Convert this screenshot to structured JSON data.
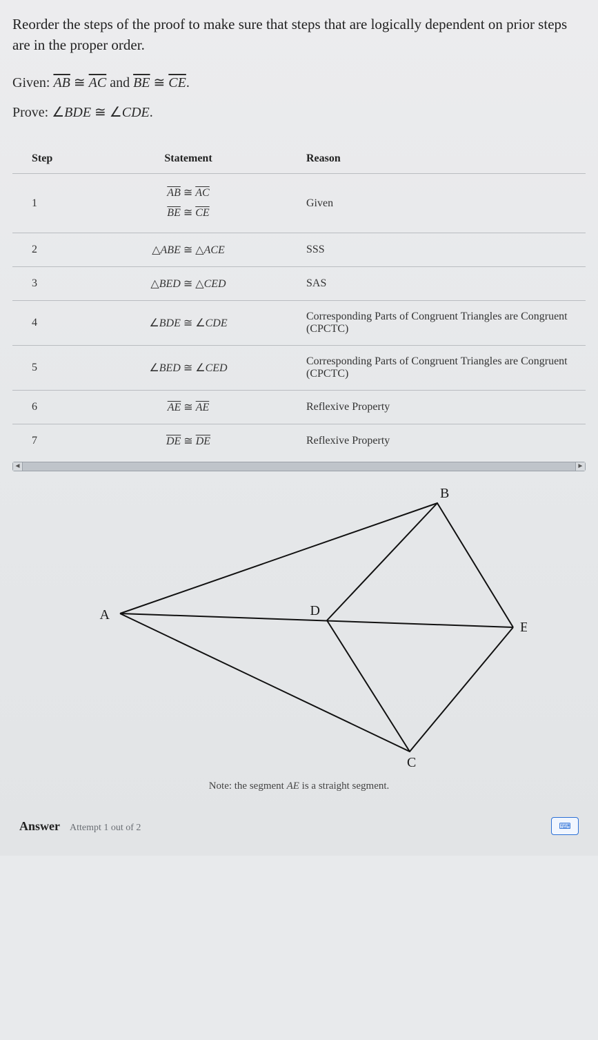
{
  "intro": "Reorder the steps of the proof to make sure that steps that are logically dependent on prior steps are in the proper order.",
  "given_label": "Given: ",
  "given_math_html": "<span class='over math'>AB</span> ≅ <span class='over math'>AC</span> and <span class='over math'>BE</span> ≅ <span class='over math'>CE</span>.",
  "prove_label": "Prove: ",
  "prove_math_html": "∠<span class='math'>BDE</span> ≅ ∠<span class='math'>CDE</span>.",
  "headers": {
    "step": "Step",
    "statement": "Statement",
    "reason": "Reason"
  },
  "rows": [
    {
      "step": "1",
      "statement_html": "<div class='stmt-line'><span class='over math'>AB</span> ≅ <span class='over math'>AC</span></div><div class='stmt-line'><span class='over math'>BE</span> ≅ <span class='over math'>CE</span></div>",
      "reason": "Given"
    },
    {
      "step": "2",
      "statement_html": "<span class='tri'>△<span class='math'>ABE</span></span> ≅ <span class='tri'>△<span class='math'>ACE</span></span>",
      "reason": "SSS"
    },
    {
      "step": "3",
      "statement_html": "<span class='tri'>△<span class='math'>BED</span></span> ≅ <span class='tri'>△<span class='math'>CED</span></span>",
      "reason": "SAS"
    },
    {
      "step": "4",
      "statement_html": "∠<span class='math'>BDE</span> ≅ ∠<span class='math'>CDE</span>",
      "reason": "Corresponding Parts of Congruent Triangles are Congruent (CPCTC)"
    },
    {
      "step": "5",
      "statement_html": "∠<span class='math'>BED</span> ≅ ∠<span class='math'>CED</span>",
      "reason": "Corresponding Parts of Congruent Triangles are Congruent (CPCTC)"
    },
    {
      "step": "6",
      "statement_html": "<span class='over math'>AE</span> ≅ <span class='over math'>AE</span>",
      "reason": "Reflexive Property"
    },
    {
      "step": "7",
      "statement_html": "<span class='over math'>DE</span> ≅ <span class='over math'>DE</span>",
      "reason": "Reflexive Property"
    }
  ],
  "figure": {
    "labels": {
      "A": "A",
      "B": "B",
      "C": "C",
      "D": "D",
      "E": "E"
    }
  },
  "note_html": "Note: the segment <span class='math'>AE</span> is a straight segment.",
  "answer": {
    "label": "Answer",
    "attempt": "Attempt 1 out of 2"
  },
  "keypad_glyph": "⌨"
}
